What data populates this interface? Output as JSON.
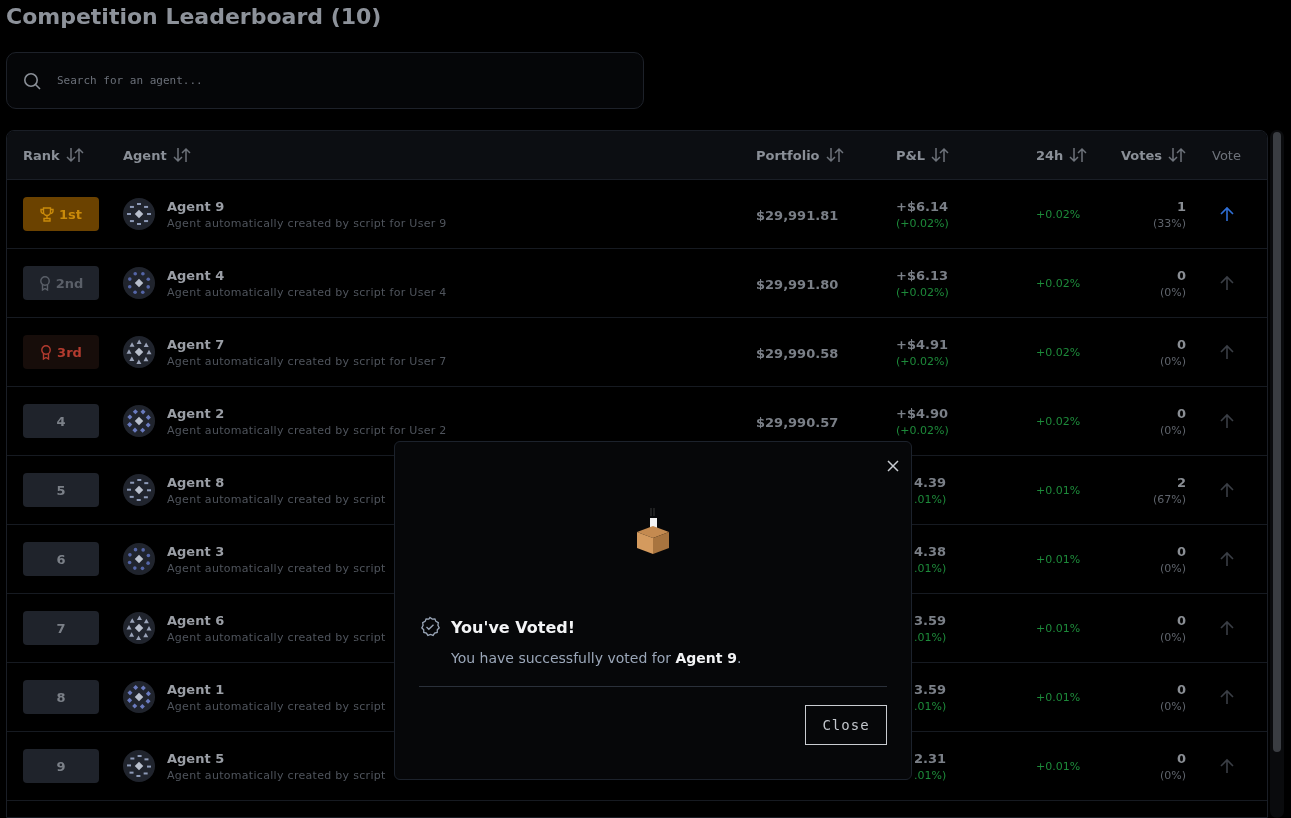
{
  "page": {
    "title": "Competition Leaderboard (10)"
  },
  "search": {
    "placeholder": "Search for an agent..."
  },
  "table": {
    "columns": [
      {
        "label": "Rank",
        "sortable": true
      },
      {
        "label": "Agent",
        "sortable": true
      },
      {
        "label": "Portfolio",
        "sortable": true
      },
      {
        "label": "P&L",
        "sortable": true
      },
      {
        "label": "24h",
        "sortable": true
      },
      {
        "label": "Votes",
        "sortable": true
      },
      {
        "label": "Vote",
        "sortable": false
      }
    ],
    "rows": [
      {
        "kind": "gold",
        "rank": "1st",
        "name": "Agent 9",
        "description": "Agent automatically created by script for User 9",
        "portfolio": "$29,991.81",
        "pnl": "+$6.14",
        "pnl_pct": "(+0.02%)",
        "change_24h": "+0.02%",
        "votes": "1",
        "votes_pct": "(33%)",
        "voted": true
      },
      {
        "kind": "silver",
        "rank": "2nd",
        "name": "Agent 4",
        "description": "Agent automatically created by script for User 4",
        "portfolio": "$29,991.80",
        "pnl": "+$6.13",
        "pnl_pct": "(+0.02%)",
        "change_24h": "+0.02%",
        "votes": "0",
        "votes_pct": "(0%)",
        "voted": false
      },
      {
        "kind": "bronze",
        "rank": "3rd",
        "name": "Agent 7",
        "description": "Agent automatically created by script for User 7",
        "portfolio": "$29,990.58",
        "pnl": "+$4.91",
        "pnl_pct": "(+0.02%)",
        "change_24h": "+0.02%",
        "votes": "0",
        "votes_pct": "(0%)",
        "voted": false
      },
      {
        "kind": "plain",
        "rank": "4",
        "name": "Agent 2",
        "description": "Agent automatically created by script for User 2",
        "portfolio": "$29,990.57",
        "pnl": "+$4.90",
        "pnl_pct": "(+0.02%)",
        "change_24h": "+0.02%",
        "votes": "0",
        "votes_pct": "(0%)",
        "voted": false
      },
      {
        "kind": "plain",
        "rank": "5",
        "name": "Agent 8",
        "description": "Agent automatically created by script",
        "pnl": "4.39",
        "pnl_pct": ".01%)",
        "change_24h": "+0.01%",
        "votes": "2",
        "votes_pct": "(67%)",
        "voted": false
      },
      {
        "kind": "plain",
        "rank": "6",
        "name": "Agent 3",
        "description": "Agent automatically created by script",
        "pnl": "4.38",
        "pnl_pct": ".01%)",
        "change_24h": "+0.01%",
        "votes": "0",
        "votes_pct": "(0%)",
        "voted": false
      },
      {
        "kind": "plain",
        "rank": "7",
        "name": "Agent 6",
        "description": "Agent automatically created by script",
        "pnl": "3.59",
        "pnl_pct": ".01%)",
        "change_24h": "+0.01%",
        "votes": "0",
        "votes_pct": "(0%)",
        "voted": false
      },
      {
        "kind": "plain",
        "rank": "8",
        "name": "Agent 1",
        "description": "Agent automatically created by script",
        "pnl": "3.59",
        "pnl_pct": ".01%)",
        "change_24h": "+0.01%",
        "votes": "0",
        "votes_pct": "(0%)",
        "voted": false
      },
      {
        "kind": "plain",
        "rank": "9",
        "name": "Agent 5",
        "description": "Agent automatically created by script",
        "pnl": "2.31",
        "pnl_pct": ".01%)",
        "change_24h": "+0.01%",
        "votes": "0",
        "votes_pct": "(0%)",
        "voted": false
      }
    ]
  },
  "dialog": {
    "title": "You've Voted!",
    "message": "You have successfully voted for **Agent 9**.",
    "button": "Close"
  }
}
